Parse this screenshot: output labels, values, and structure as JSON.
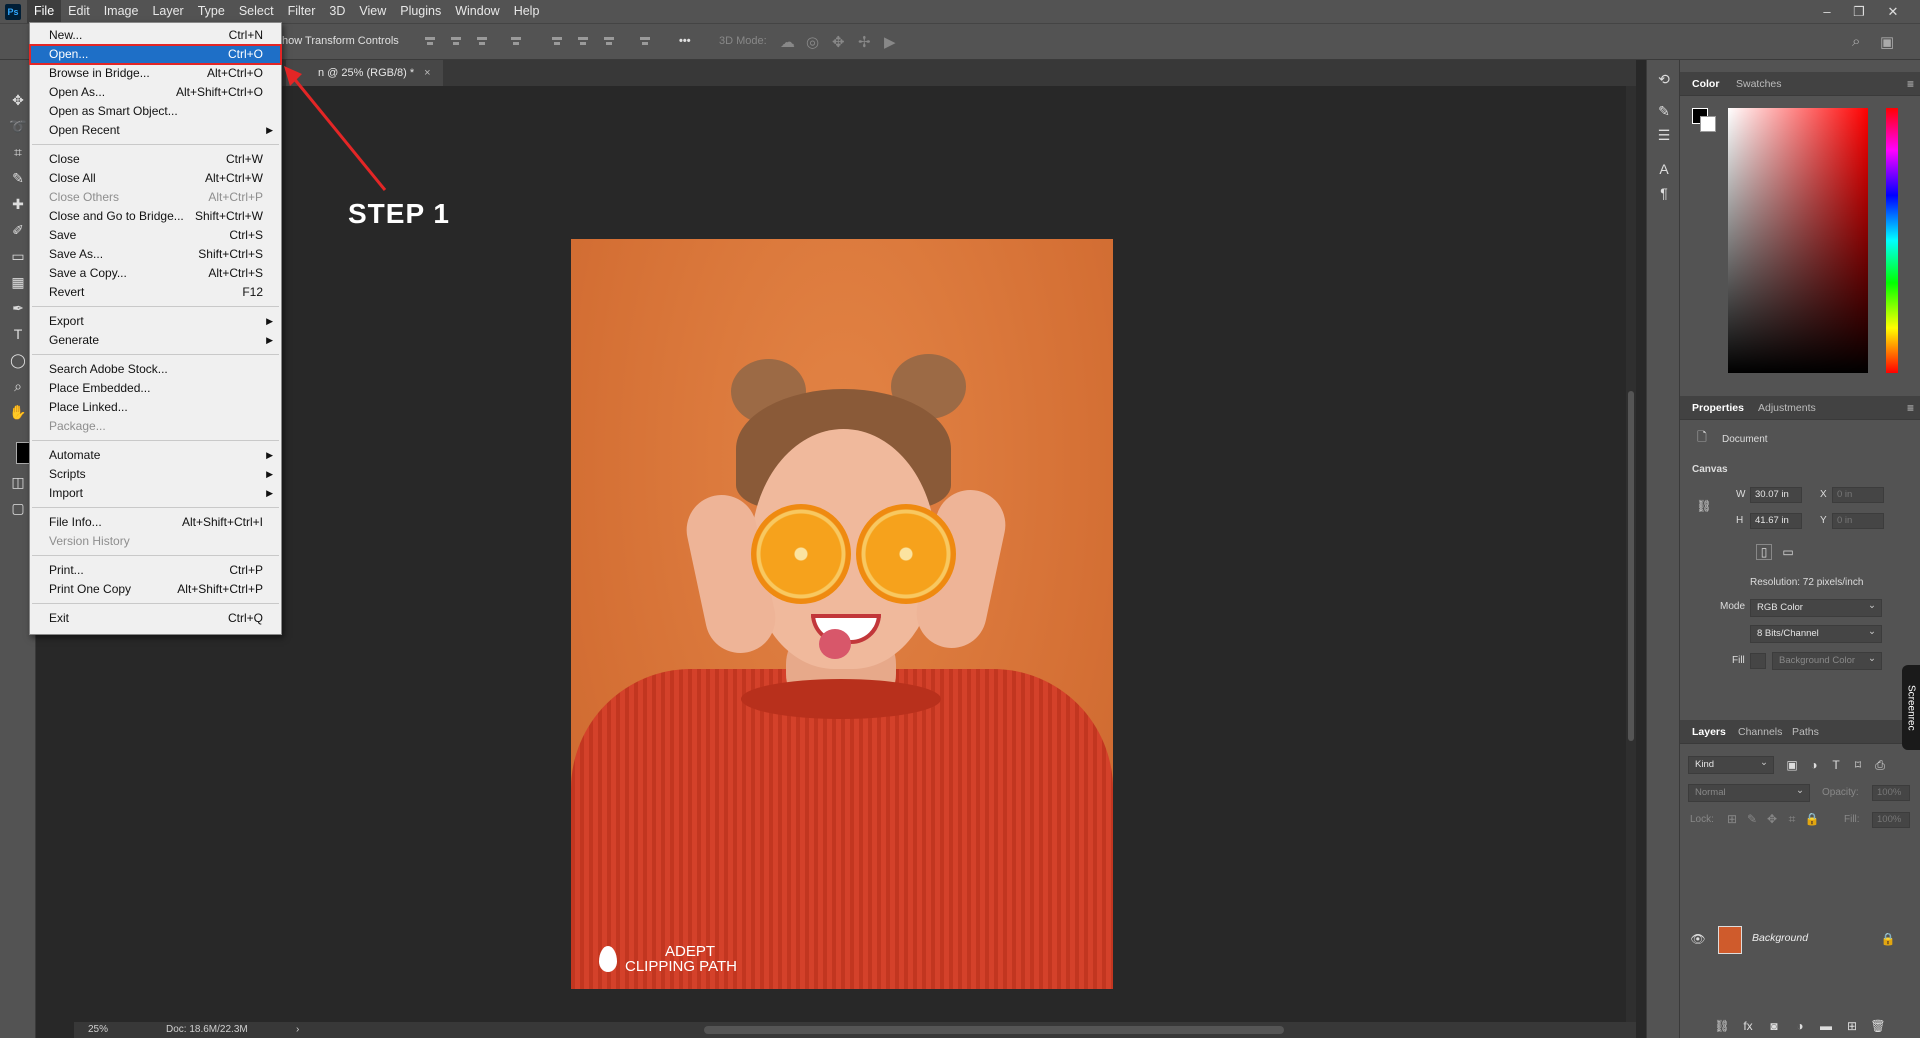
{
  "menubar": {
    "logo": "Ps",
    "items": [
      "File",
      "Edit",
      "Image",
      "Layer",
      "Type",
      "Select",
      "Filter",
      "3D",
      "View",
      "Plugins",
      "Window",
      "Help"
    ],
    "window_controls": {
      "minimize": "–",
      "restore": "❐",
      "close": "✕"
    }
  },
  "optionsbar": {
    "transform_controls": "how Transform Controls",
    "mode_3d": "3D Mode:",
    "more": "•••"
  },
  "document": {
    "tab_title": "n @ 25% (RGB/8) *",
    "tab_close": "×"
  },
  "file_menu": {
    "items": [
      {
        "label": "New...",
        "shortcut": "Ctrl+N",
        "disabled": false,
        "submenu": false
      },
      {
        "label": "Open...",
        "shortcut": "Ctrl+O",
        "disabled": false,
        "submenu": false,
        "selected": true
      },
      {
        "label": "Browse in Bridge...",
        "shortcut": "Alt+Ctrl+O",
        "disabled": false,
        "submenu": false
      },
      {
        "label": "Open As...",
        "shortcut": "Alt+Shift+Ctrl+O",
        "disabled": false,
        "submenu": false
      },
      {
        "label": "Open as Smart Object...",
        "shortcut": "",
        "disabled": false,
        "submenu": false
      },
      {
        "label": "Open Recent",
        "shortcut": "",
        "disabled": false,
        "submenu": true
      },
      {
        "label": "Close",
        "shortcut": "Ctrl+W",
        "disabled": false,
        "submenu": false
      },
      {
        "label": "Close All",
        "shortcut": "Alt+Ctrl+W",
        "disabled": false,
        "submenu": false
      },
      {
        "label": "Close Others",
        "shortcut": "Alt+Ctrl+P",
        "disabled": true,
        "submenu": false
      },
      {
        "label": "Close and Go to Bridge...",
        "shortcut": "Shift+Ctrl+W",
        "disabled": false,
        "submenu": false
      },
      {
        "label": "Save",
        "shortcut": "Ctrl+S",
        "disabled": false,
        "submenu": false
      },
      {
        "label": "Save As...",
        "shortcut": "Shift+Ctrl+S",
        "disabled": false,
        "submenu": false
      },
      {
        "label": "Save a Copy...",
        "shortcut": "Alt+Ctrl+S",
        "disabled": false,
        "submenu": false
      },
      {
        "label": "Revert",
        "shortcut": "F12",
        "disabled": false,
        "submenu": false
      },
      {
        "label": "Export",
        "shortcut": "",
        "disabled": false,
        "submenu": true
      },
      {
        "label": "Generate",
        "shortcut": "",
        "disabled": false,
        "submenu": true
      },
      {
        "label": "Search Adobe Stock...",
        "shortcut": "",
        "disabled": false,
        "submenu": false
      },
      {
        "label": "Place Embedded...",
        "shortcut": "",
        "disabled": false,
        "submenu": false
      },
      {
        "label": "Place Linked...",
        "shortcut": "",
        "disabled": false,
        "submenu": false
      },
      {
        "label": "Package...",
        "shortcut": "",
        "disabled": true,
        "submenu": false
      },
      {
        "label": "Automate",
        "shortcut": "",
        "disabled": false,
        "submenu": true
      },
      {
        "label": "Scripts",
        "shortcut": "",
        "disabled": false,
        "submenu": true
      },
      {
        "label": "Import",
        "shortcut": "",
        "disabled": false,
        "submenu": true
      },
      {
        "label": "File Info...",
        "shortcut": "Alt+Shift+Ctrl+I",
        "disabled": false,
        "submenu": false
      },
      {
        "label": "Version History",
        "shortcut": "",
        "disabled": true,
        "submenu": false
      },
      {
        "label": "Print...",
        "shortcut": "Ctrl+P",
        "disabled": false,
        "submenu": false
      },
      {
        "label": "Print One Copy",
        "shortcut": "Alt+Shift+Ctrl+P",
        "disabled": false,
        "submenu": false
      },
      {
        "label": "Exit",
        "shortcut": "Ctrl+Q",
        "disabled": false,
        "submenu": false
      }
    ]
  },
  "annotation": {
    "step_label": "STEP 1",
    "arrow_color": "#e32626"
  },
  "watermark": {
    "line1": "ADEPT",
    "line2": "CLIPPING PATH"
  },
  "statusbar": {
    "zoom": "25%",
    "doc_size": "Doc: 18.6M/22.3M",
    "arrow": "›"
  },
  "color_panel": {
    "tabs": [
      "Color",
      "Swatches"
    ]
  },
  "properties_panel": {
    "tabs": [
      "Properties",
      "Adjustments"
    ],
    "doc_label": "Document",
    "section": "Canvas",
    "w_label": "W",
    "w_value": "30.07 in",
    "h_label": "H",
    "h_value": "41.67 in",
    "x_label": "X",
    "x_value": "0 in",
    "y_label": "Y",
    "y_value": "0 in",
    "resolution": "Resolution: 72 pixels/inch",
    "mode_label": "Mode",
    "mode_value": "RGB Color",
    "bits_value": "8 Bits/Channel",
    "fill_label": "Fill",
    "fill_value": "Background Color"
  },
  "layers_panel": {
    "tabs": [
      "Layers",
      "Channels",
      "Paths"
    ],
    "kind": "Kind",
    "blend": "Normal",
    "opacity_label": "Opacity:",
    "opacity_value": "100%",
    "lock_label": "Lock:",
    "fill_label": "Fill:",
    "fill_value": "100%",
    "layer_name": "Background"
  },
  "rec_badge": "Screenrec",
  "colors": {
    "accent_selected": "#1e6fc7",
    "highlight_red": "#e32626",
    "photo_background": "#d9743a",
    "sweater": "#d33b23"
  }
}
